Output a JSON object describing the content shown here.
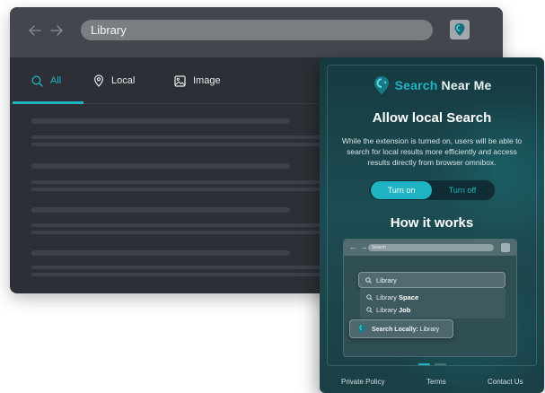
{
  "browser": {
    "address_value": "Library",
    "back_icon": "arrow-left-icon",
    "forward_icon": "arrow-right-icon",
    "extension_icon": "location-pin-icon",
    "tabs": [
      {
        "label": "All",
        "icon": "search-icon",
        "active": true
      },
      {
        "label": "Local",
        "icon": "map-pin-icon",
        "active": false
      },
      {
        "label": "Image",
        "icon": "image-icon",
        "active": false
      }
    ],
    "accent_color": "#1fb3c4"
  },
  "popup": {
    "brand": {
      "part1": "Search",
      "part2": " Near Me",
      "logo_icon": "location-pin-icon"
    },
    "title": "Allow local Search",
    "description": "While the extension is turned on, users will be able to search for local results more efficiently and access results directly from browser omnibox.",
    "toggle": {
      "on_label": "Turn on",
      "off_label": "Turn off",
      "selected": "Turn on"
    },
    "how_title": "How it works",
    "preview": {
      "address": "Search",
      "search_value": "Library",
      "suggestions": [
        {
          "prefix": "Library ",
          "bold": "Space"
        },
        {
          "prefix": "Library ",
          "bold": "Job"
        }
      ],
      "local_prefix": "Search Locally:",
      "local_value": " Library"
    },
    "footer": {
      "privacy": "Private Policy",
      "terms": "Terms",
      "contact": "Contact Us"
    }
  }
}
